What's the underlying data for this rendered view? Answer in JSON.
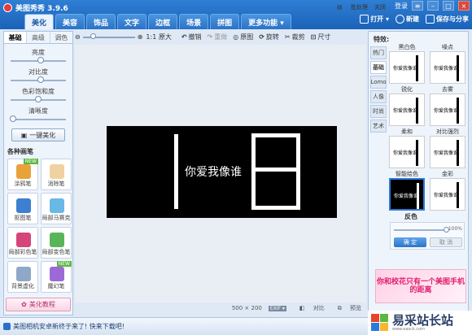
{
  "app": {
    "title": "美图秀秀 3.9.6",
    "login": "登录"
  },
  "tabs": [
    "美化",
    "美容",
    "饰品",
    "文字",
    "边框",
    "场景",
    "拼图",
    "更多功能 ▾"
  ],
  "top_actions": {
    "open": "打开 ▾",
    "new": "新建",
    "save": "保存与分享"
  },
  "left": {
    "subtabs": [
      "基础",
      "高级",
      "调色"
    ],
    "sliders": [
      {
        "label": "亮度",
        "value": 0.55
      },
      {
        "label": "对比度",
        "value": 0.55
      },
      {
        "label": "色彩饱和度",
        "value": 0.5
      },
      {
        "label": "清晰度",
        "value": 0.05
      }
    ],
    "onekey": "一键美化",
    "brush_title": "各种画笔",
    "brushes": [
      {
        "label": "涂鸦笔",
        "color": "#e8a23a",
        "new": true
      },
      {
        "label": "消除笔",
        "color": "#f0d2a0",
        "new": false
      },
      {
        "label": "抠图笔",
        "color": "#3d7fd1",
        "new": false
      },
      {
        "label": "局部马赛克",
        "color": "#6ab8e6",
        "new": false
      },
      {
        "label": "局部彩色笔",
        "color": "#d6457a",
        "new": false
      },
      {
        "label": "局部变色笔",
        "color": "#58b55a",
        "new": false
      },
      {
        "label": "背景虚化",
        "color": "#8fa8c8",
        "new": false
      },
      {
        "label": "魔幻笔",
        "color": "#9c6ad6",
        "new": true
      }
    ],
    "new_tag": "NEW",
    "tutorial": "美化教程"
  },
  "toolbar": {
    "zoom_label": "1:1 原大",
    "zoom_value": 0.15,
    "undo": "撤销",
    "redo": "重做",
    "reset": "原图",
    "rotate": "旋转",
    "crop": "裁剪",
    "size": "尺寸"
  },
  "image": {
    "text": "你爱我像谁"
  },
  "canvas_status": {
    "dims": "500 × 200",
    "exif": "EXIF ▾",
    "compare": "对比",
    "preview": "预览"
  },
  "right": {
    "title": "特效:",
    "vtabs": [
      "热门",
      "基础",
      "Lomo",
      "人像",
      "时尚",
      "艺术"
    ],
    "effects": [
      {
        "label": "黑白色",
        "sel": false
      },
      {
        "label": "噪点",
        "sel": false
      },
      {
        "label": "锐化",
        "sel": false
      },
      {
        "label": "去雾",
        "sel": false
      },
      {
        "label": "柔和",
        "sel": false
      },
      {
        "label": "对比强烈",
        "sel": false
      },
      {
        "label": "智能绘色",
        "sel": true
      },
      {
        "label": "金彩",
        "sel": false
      }
    ],
    "thumb_text": "你爱我像谁",
    "selected_label": "反色",
    "strength": "100%",
    "ok": "确 定",
    "cancel": "取 消",
    "ad": "你和校花只有一个美图手机的距离"
  },
  "statusbar": {
    "news": "美图相机安卓新终于来了! 快来下载吧!",
    "batch": "批处理",
    "close": "关闭"
  },
  "watermark": {
    "title": "易采站长站",
    "sub": "www.easck.com"
  }
}
